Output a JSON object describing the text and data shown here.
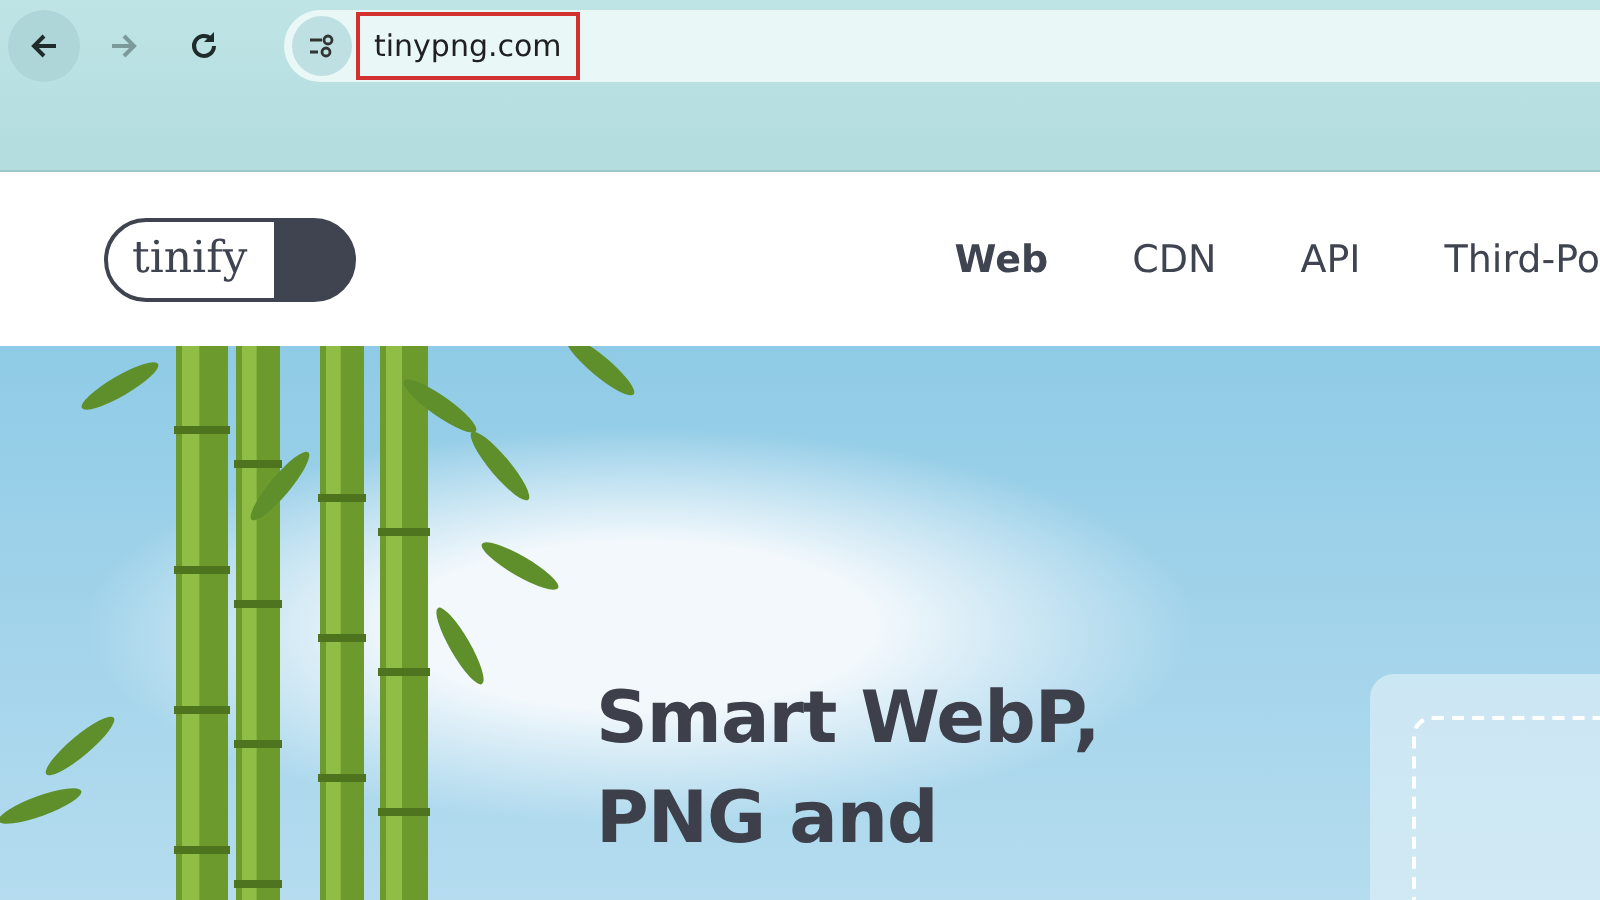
{
  "browser": {
    "buttons": [
      {
        "kind": "back",
        "disabled": false
      },
      {
        "kind": "forward",
        "disabled": true
      },
      {
        "kind": "reload",
        "disabled": false
      }
    ],
    "address_bar": {
      "url": "tinypng.com",
      "highlighted": true
    }
  },
  "site_header": {
    "logo": "tinify",
    "nav": [
      {
        "label": "Web",
        "selected": true
      },
      {
        "label": "CDN",
        "selected": false
      },
      {
        "label": "API",
        "selected": false
      },
      {
        "label": "Third-Po",
        "selected": false
      }
    ]
  },
  "hero": {
    "heading": "Smart WebP, PNG and"
  }
}
